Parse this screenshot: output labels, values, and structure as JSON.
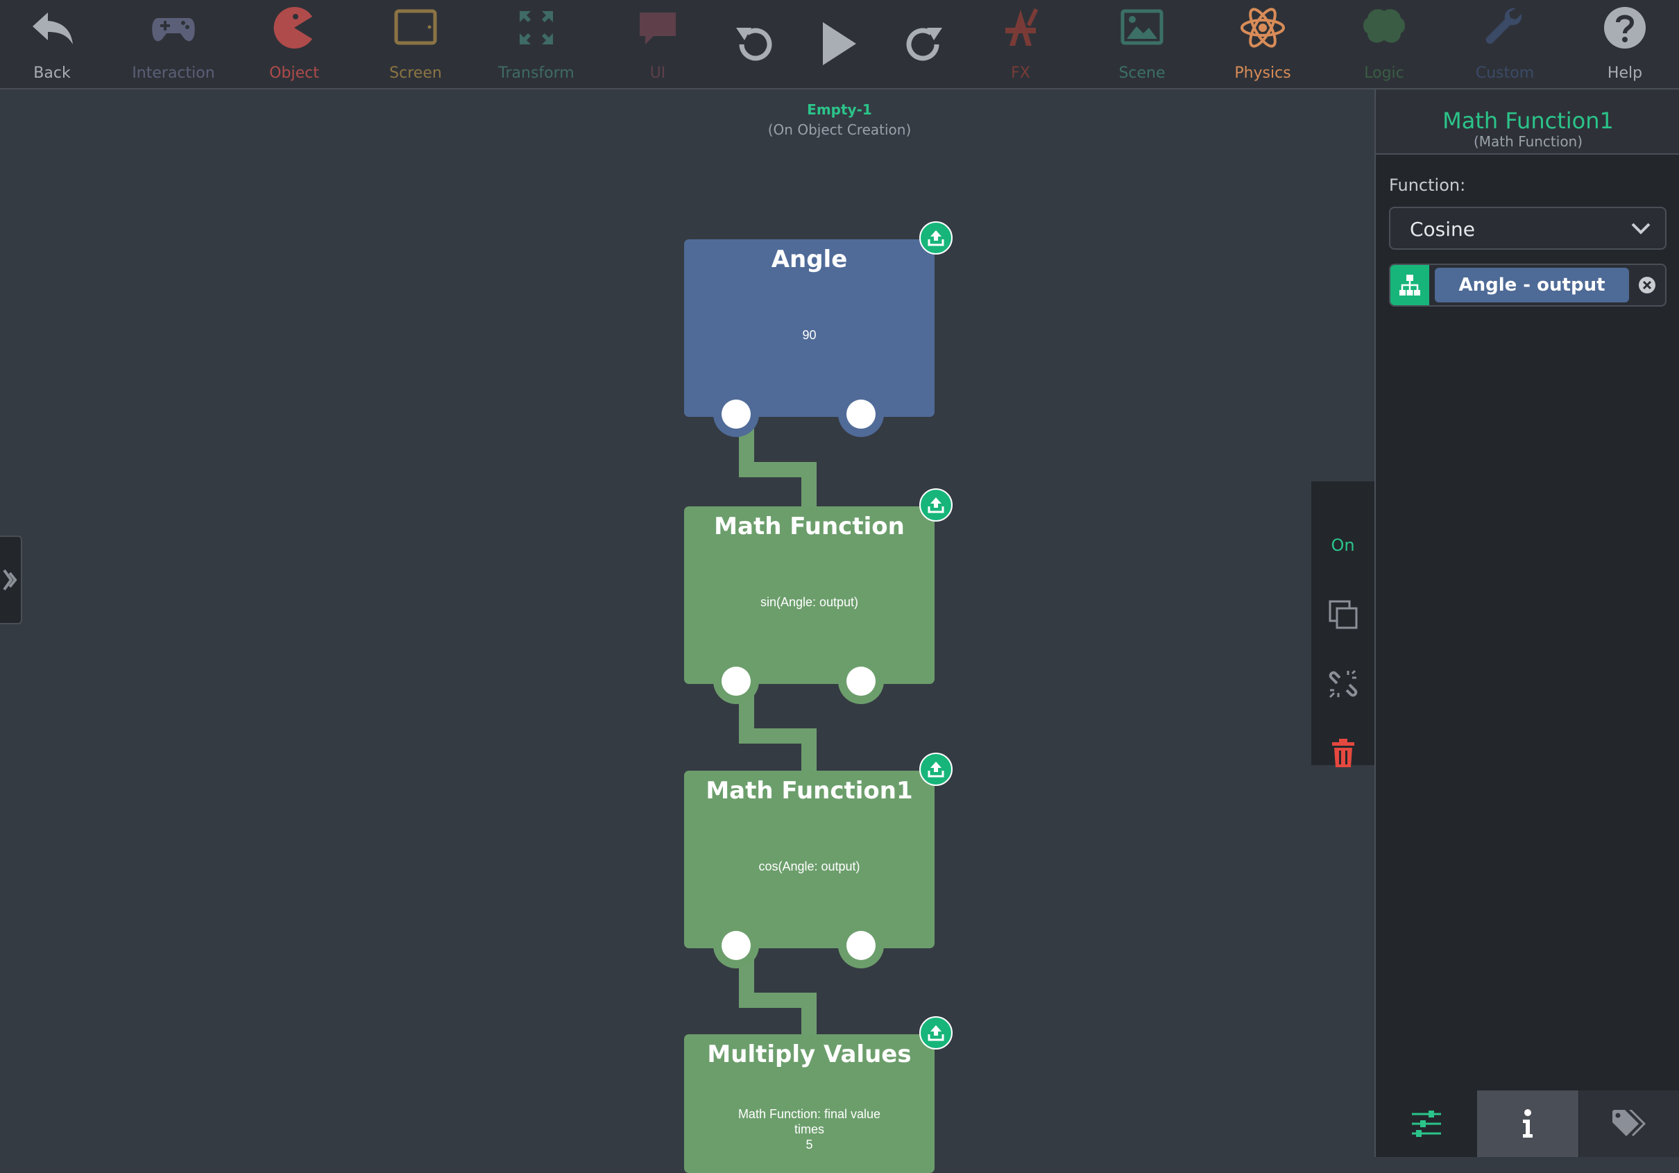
{
  "toolbar": {
    "items": [
      {
        "label": "Back",
        "icon": "back-arrow-icon",
        "color": "#a9aeb5"
      },
      {
        "label": "Interaction",
        "icon": "gamepad-icon",
        "color": "#5b5f78"
      },
      {
        "label": "Object",
        "icon": "pacman-icon",
        "color": "#b04b4b"
      },
      {
        "label": "Screen",
        "icon": "tablet-icon",
        "color": "#8c7444"
      },
      {
        "label": "Transform",
        "icon": "expand-arrows-icon",
        "color": "#3f6a66"
      },
      {
        "label": "UI",
        "icon": "speech-bubble-icon",
        "color": "#5e3f4a"
      },
      {
        "label": "FX",
        "icon": "fx-brush-icon",
        "color": "#7a3b37"
      },
      {
        "label": "Scene",
        "icon": "landscape-image-icon",
        "color": "#3c7067"
      },
      {
        "label": "Physics",
        "icon": "atom-icon",
        "color": "#d98c58"
      },
      {
        "label": "Logic",
        "icon": "brain-icon",
        "color": "#3a5c44"
      },
      {
        "label": "Custom",
        "icon": "wrench-icon",
        "color": "#3b4a66"
      },
      {
        "label": "Help",
        "icon": "help-question-icon",
        "color": "#a9aeb5"
      }
    ],
    "controls": [
      "undo-icon",
      "play-icon",
      "redo-icon"
    ]
  },
  "context": {
    "object_name": "Empty-1",
    "trigger": "(On Object Creation)"
  },
  "nodes": [
    {
      "title": "Angle",
      "body": [
        "90"
      ],
      "color": "#506b98",
      "kind": "angle"
    },
    {
      "title": "Math Function",
      "body": [
        "sin(Angle: output)"
      ],
      "color": "#6c9e6c",
      "kind": "math-function"
    },
    {
      "title": "Math Function1",
      "body": [
        "cos(Angle: output)"
      ],
      "color": "#6c9e6c",
      "kind": "math-function1"
    },
    {
      "title": "Multiply Values",
      "body": [
        "Math Function: final value",
        "times",
        "5"
      ],
      "color": "#6c9e6c",
      "kind": "multiply-values"
    }
  ],
  "actions": {
    "toggle_label": "On",
    "buttons": [
      "duplicate-icon",
      "unlink-icon",
      "delete-trash-icon"
    ]
  },
  "inspector": {
    "title": "Math Function1",
    "subtitle": "(Math Function)",
    "function_label": "Function:",
    "function_value": "Cosine",
    "input_chip": "Angle - output",
    "tabs": [
      {
        "icon": "sliders-icon",
        "active": false
      },
      {
        "icon": "info-icon",
        "active": true
      },
      {
        "icon": "tags-icon",
        "active": false
      }
    ]
  },
  "colors": {
    "accent": "#2bc48a",
    "canvas": "#353b43",
    "panel": "#23272c",
    "delete": "#e5483f"
  }
}
